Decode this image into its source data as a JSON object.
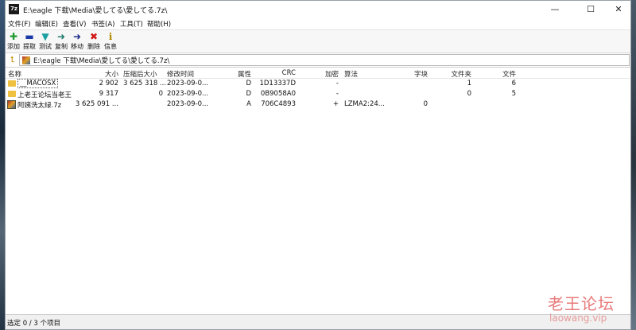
{
  "window": {
    "app_icon": "7z",
    "title": "E:\\eagle 下载\\Media\\愛してる\\愛してる.7z\\",
    "controls": {
      "minimize": "—",
      "maximize": "☐",
      "close": "✕"
    }
  },
  "menu": [
    {
      "label": "文件(F)"
    },
    {
      "label": "编辑(E)"
    },
    {
      "label": "查看(V)"
    },
    {
      "label": "书签(A)"
    },
    {
      "label": "工具(T)"
    },
    {
      "label": "帮助(H)"
    }
  ],
  "toolbar": [
    {
      "label": "添加",
      "icon": "add-icon",
      "glyph": "✚",
      "color": "#1f9a2e"
    },
    {
      "label": "提取",
      "icon": "extract-icon",
      "glyph": "▬",
      "color": "#1a3aa8"
    },
    {
      "label": "测试",
      "icon": "test-icon",
      "glyph": "▼",
      "color": "#1aa0a0"
    },
    {
      "label": "复制",
      "icon": "copy-icon",
      "glyph": "➜",
      "color": "#1a7a6a"
    },
    {
      "label": "移动",
      "icon": "move-icon",
      "glyph": "➜",
      "color": "#1a2a8a"
    },
    {
      "label": "删除",
      "icon": "delete-icon",
      "glyph": "✖",
      "color": "#d01818"
    },
    {
      "label": "信息",
      "icon": "info-icon",
      "glyph": "ℹ",
      "color": "#b08a00"
    }
  ],
  "address": {
    "path": "E:\\eagle 下载\\Media\\愛してる\\愛してる.7z\\"
  },
  "columns": {
    "name": "名称",
    "size": "大小",
    "packed": "压缩后大小",
    "modified": "修改时间",
    "attributes": "属性",
    "crc": "CRC",
    "encrypted": "加密",
    "method": "算法",
    "block": "字块",
    "folders": "文件夹",
    "files": "文件"
  },
  "rows": [
    {
      "name": "__MACOSX",
      "type": "folder",
      "size": "2 902",
      "packed": "3 625 318 ...",
      "modified": "2023-09-0...",
      "attributes": "D",
      "crc": "1D13337D",
      "encrypted": "-",
      "method": "",
      "block": "",
      "folders": "1",
      "files": "6"
    },
    {
      "name": "上老王论坛当老王",
      "type": "folder",
      "size": "9 317",
      "packed": "0",
      "modified": "2023-09-0...",
      "attributes": "D",
      "crc": "0B9058A0",
      "encrypted": "-",
      "method": "",
      "block": "",
      "folders": "0",
      "files": "5"
    },
    {
      "name": "阿姨洗太绿.7z",
      "type": "archive",
      "size": "3 625 091 ...",
      "packed": "",
      "modified": "2023-09-0...",
      "attributes": "A",
      "crc": "706C4893",
      "encrypted": "+",
      "method": "LZMA2:24...",
      "block": "0",
      "folders": "",
      "files": ""
    }
  ],
  "status": {
    "text": "选定 0 / 3 个项目"
  },
  "watermark": {
    "cn": "老王论坛",
    "en": "laowang.vip"
  }
}
